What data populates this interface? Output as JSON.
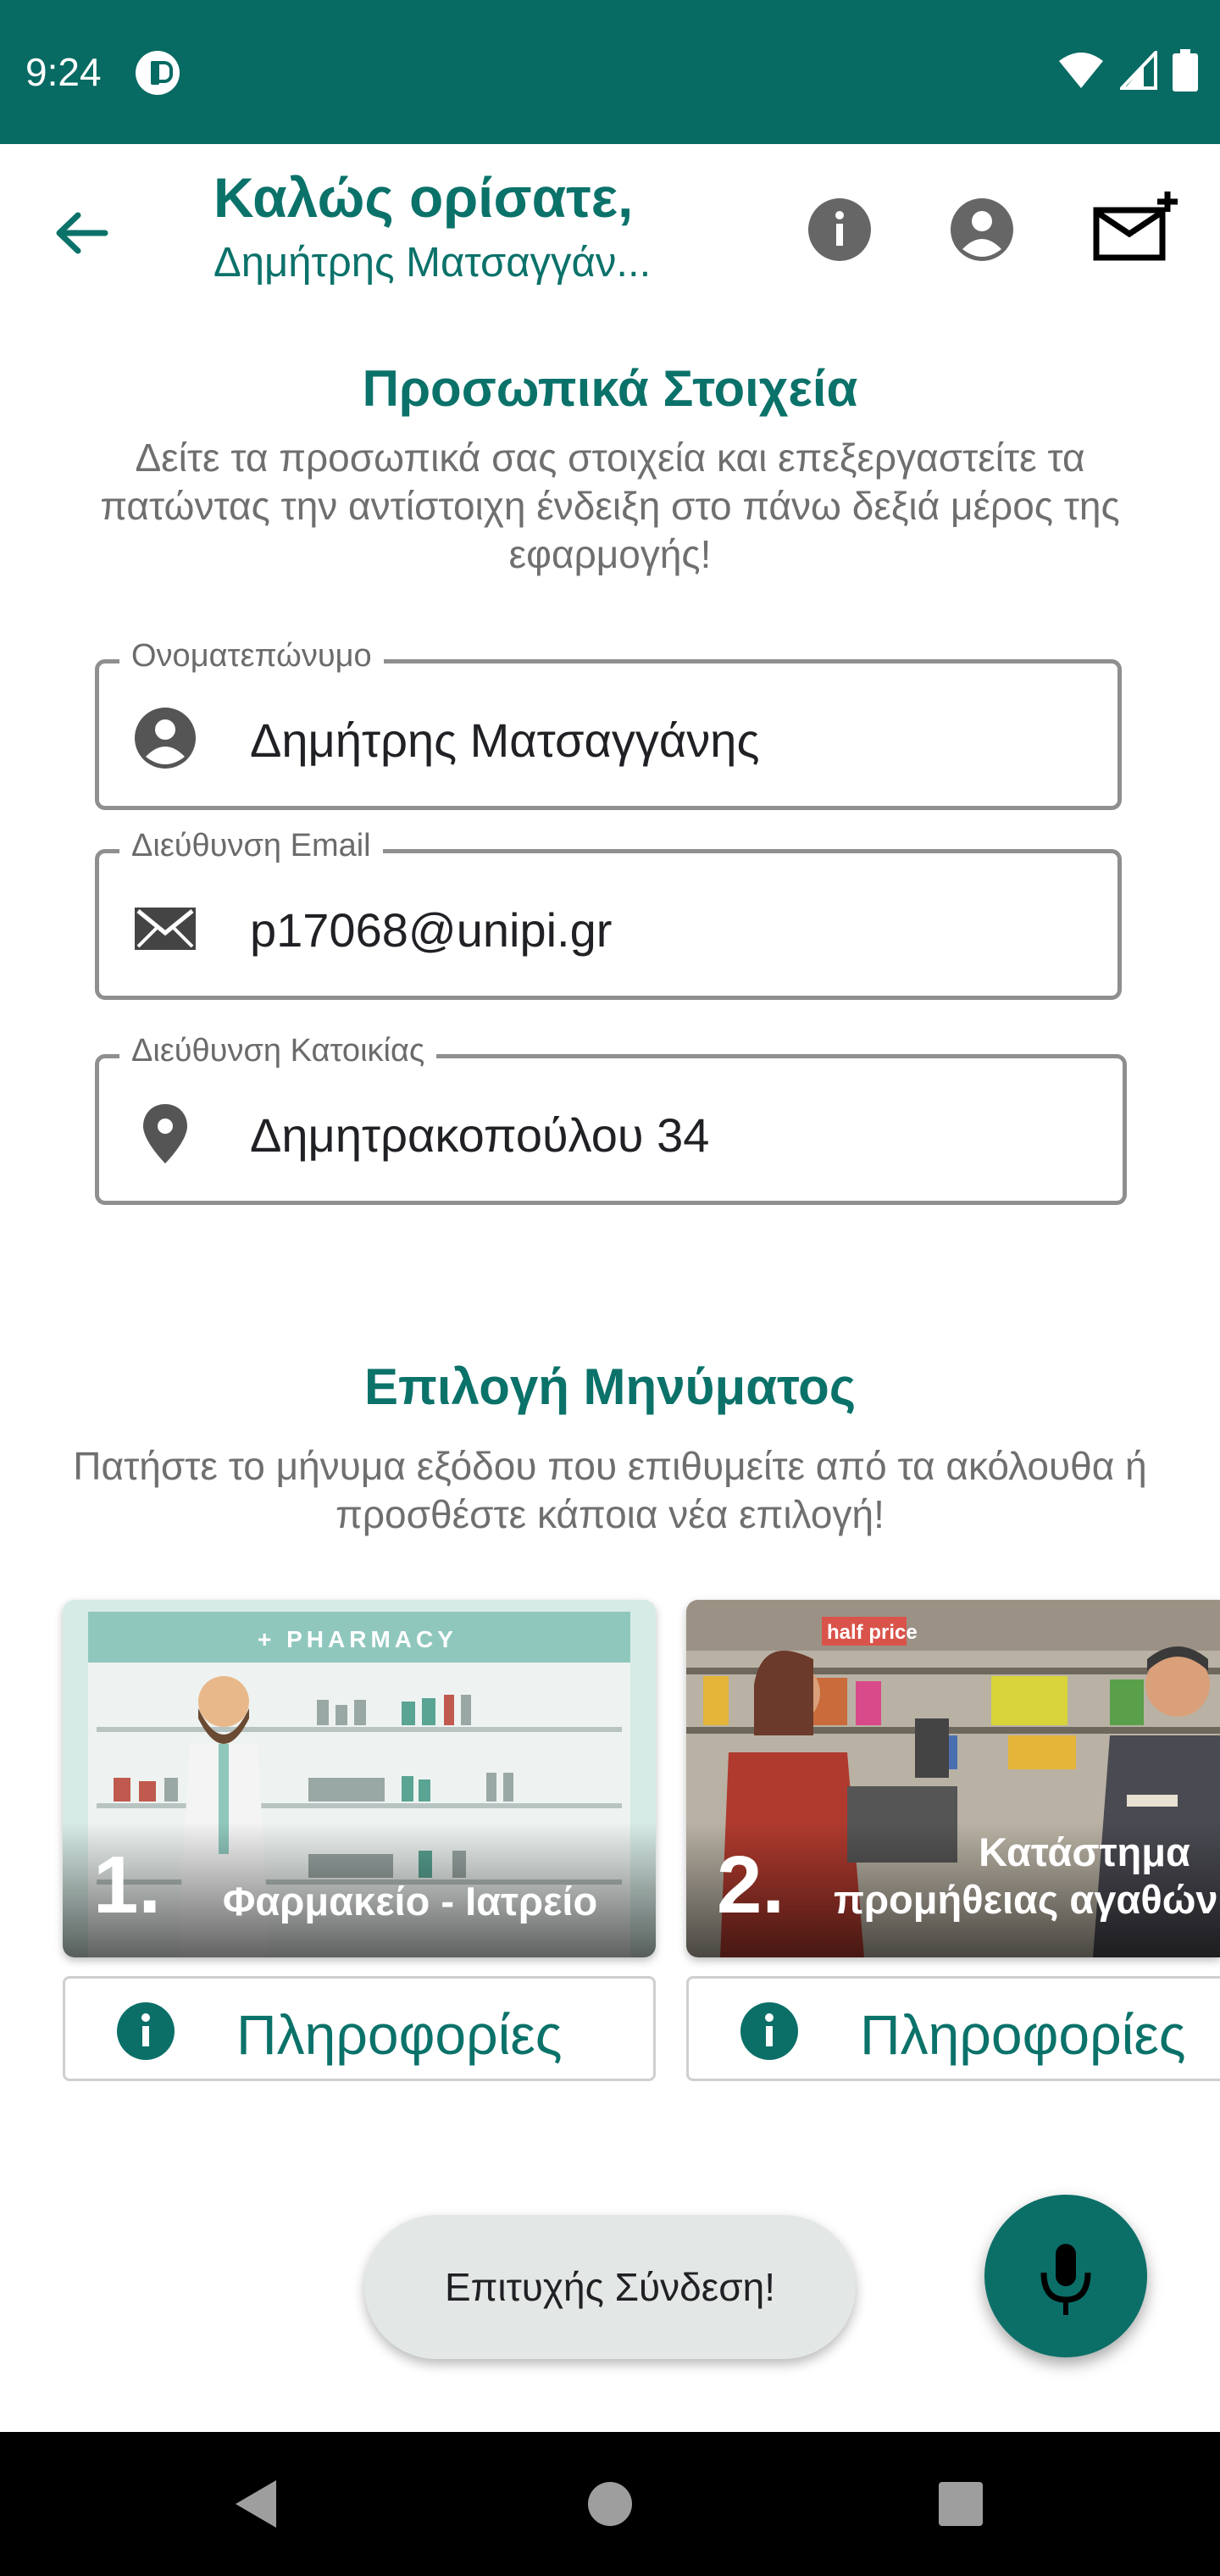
{
  "status_bar": {
    "time": "9:24",
    "icons": [
      "app-icon",
      "wifi-icon",
      "signal-icon",
      "battery-icon"
    ]
  },
  "app_bar": {
    "title": "Καλώς ορίσατε,",
    "user_name": "Δημήτρης Ματσαγγάν...",
    "icons": [
      "back-arrow-icon",
      "info-icon",
      "account-icon",
      "add-message-icon"
    ]
  },
  "personal_info": {
    "title": "Προσωπικά Στοιχεία",
    "description": "Δείτε τα προσωπικά σας στοιχεία και επεξεργαστείτε τα πατώντας την αντίστοιχη ένδειξη στο πάνω δεξιά μέρος της εφαρμογής!",
    "fields": [
      {
        "label": "Ονοματεπώνυμο",
        "value": "Δημήτρης Ματσαγγάνης",
        "icon": "account-icon"
      },
      {
        "label": "Διεύθυνση Email",
        "value": "p17068@unipi.gr",
        "icon": "mail-icon"
      },
      {
        "label": "Διεύθυνση Κατοικίας",
        "value": "Δημητρακοπούλου 34",
        "icon": "location-pin-icon"
      }
    ]
  },
  "message_selection": {
    "title": "Επιλογή Μηνύματος",
    "description": "Πατήστε το μήνυμα εξόδου που επιθυμείτε από τα ακόλουθα ή προσθέστε κάποια νέα επιλογή!",
    "cards": [
      {
        "number": "1.",
        "label": "Φαρμακείο - Ιατρείο",
        "sign": "+ PHARMACY",
        "info_label": "Πληροφορίες"
      },
      {
        "number": "2.",
        "label_line1": "Κατάστημα",
        "label_line2": "προμήθειας αγαθών",
        "sign": "half price",
        "info_label": "Πληροφορίες"
      }
    ]
  },
  "toast": {
    "text": "Επιτυχής Σύνδεση!"
  },
  "fab": {
    "icon": "microphone-icon"
  },
  "colors": {
    "primary": "#076a63",
    "accent_text": "#0b726a",
    "toast_bg": "#e3e7e5"
  }
}
